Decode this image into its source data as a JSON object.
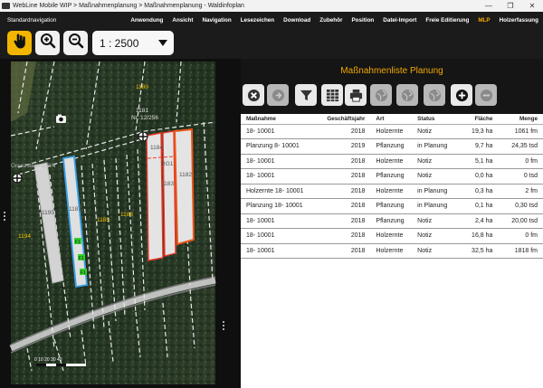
{
  "window": {
    "title": "WebLine Mobile WIP > Maßnahmenplanung > Maßnahmenplanung - Waldinfoplan",
    "minimize_glyph": "—",
    "maximize_glyph": "❐",
    "close_glyph": "✕"
  },
  "menubar": {
    "brand": "Standardnavigation",
    "items": [
      {
        "label": "Anwendung"
      },
      {
        "label": "Ansicht"
      },
      {
        "label": "Navigation"
      },
      {
        "label": "Lesezeichen"
      },
      {
        "label": "Download"
      },
      {
        "label": "Zubehör"
      },
      {
        "label": "Position"
      },
      {
        "label": "Datei-Import"
      },
      {
        "label": "Freie Editierung"
      },
      {
        "label": "MLP",
        "active": true
      },
      {
        "label": "Holzerfassung"
      }
    ],
    "active_color": "#f2a900"
  },
  "toolbar": {
    "pan_icon": "hand-pointer-icon",
    "zoom_in_icon": "zoom-in-icon",
    "zoom_out_icon": "zoom-out-icon",
    "scale_value": "1 : 2500",
    "active_color": "#f2b500"
  },
  "map": {
    "labels": {
      "stand_top": "1180",
      "parcel_no": "Nr. 12/256",
      "stand_1181": "1181",
      "boundary": "Grenzstein 123/4",
      "stand_1184": "1184",
      "stand_1183": "1183",
      "stand_1182": "1182",
      "stand_1185": "1185",
      "stand_1186": "1186",
      "stand_1187": "1187",
      "stand_1194": "1194",
      "stand_1195": "1195",
      "marker_f1": "F1",
      "rg": "RG1"
    },
    "scale_bar": "0  10  20   30  40"
  },
  "panel": {
    "title": "Maßnahmenliste Planung",
    "tools": [
      {
        "name": "delete-button",
        "icon": "close-circle-icon"
      },
      {
        "name": "forward-button",
        "icon": "arrow-right-circle-icon",
        "disabled": true
      },
      {
        "name": "filter-button",
        "icon": "filter-icon"
      },
      {
        "name": "table-view-button",
        "icon": "grid-icon"
      },
      {
        "name": "print-button",
        "icon": "printer-icon"
      },
      {
        "name": "globe-button-1",
        "icon": "globe-icon",
        "disabled": true
      },
      {
        "name": "globe-button-2",
        "icon": "globe-icon",
        "disabled": true
      },
      {
        "name": "globe-button-3",
        "icon": "globe-icon",
        "disabled": true
      },
      {
        "name": "add-button",
        "icon": "plus-circle-icon"
      },
      {
        "name": "remove-button",
        "icon": "minus-circle-icon",
        "disabled": true
      }
    ],
    "columns": [
      "Maßnahme",
      "Geschäftsjahr",
      "Art",
      "Status",
      "Fläche",
      "Menge"
    ],
    "rows": [
      [
        "18- 10001",
        "2018",
        "Holzernte",
        "Notiz",
        "19,3 ha",
        "1061 fm"
      ],
      [
        "Planzung 8- 10001",
        "2019",
        "Pflanzung",
        "in Planung",
        "9,7 ha",
        "24,35 tsd"
      ],
      [
        "18- 10001",
        "2018",
        "Holzernte",
        "Notiz",
        "5,1 ha",
        "0 fm"
      ],
      [
        "18- 10001",
        "2018",
        "Pflanzung",
        "Notiz",
        "0,0 ha",
        "0 tsd"
      ],
      [
        "Holzernte 18- 10001",
        "2018",
        "Holzernte",
        "in Planung",
        "0,3 ha",
        "2 fm"
      ],
      [
        "Planzung 18- 10001",
        "2018",
        "Pflanzung",
        "in Planung",
        "0,1 ha",
        "0,30 tsd"
      ],
      [
        "18- 10001",
        "2018",
        "Pflanzung",
        "Notiz",
        "2,4 ha",
        "20,00 tsd"
      ],
      [
        "18- 10001",
        "2018",
        "Holzernte",
        "Notiz",
        "16,8 ha",
        "0 fm"
      ],
      [
        "18- 10001",
        "2018",
        "Holzernte",
        "Notiz",
        "32,5 ha",
        "1818 fm"
      ]
    ]
  }
}
